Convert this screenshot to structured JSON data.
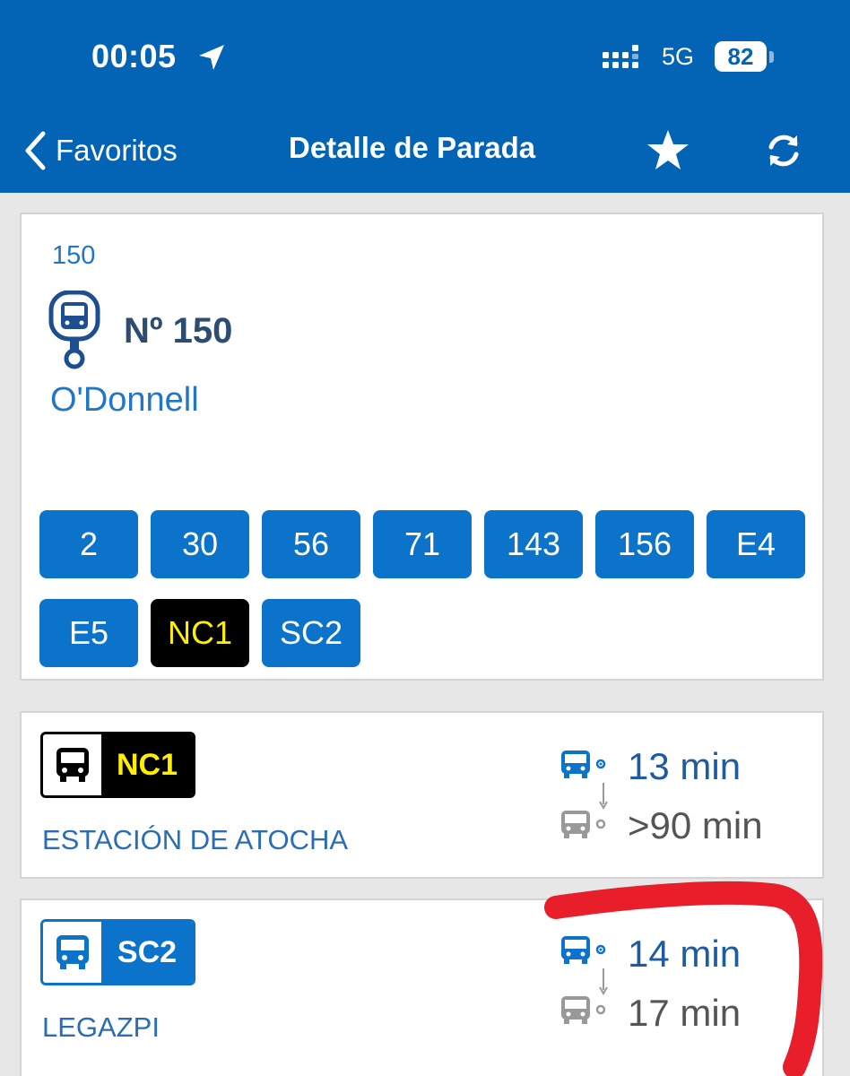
{
  "status_bar": {
    "time": "00:05",
    "network": "5G",
    "battery": "82"
  },
  "nav": {
    "back_label": "Favoritos",
    "title": "Detalle de Parada"
  },
  "stop": {
    "code": "150",
    "number_label": "Nº 150",
    "name": "O'Donnell",
    "lines": [
      "2",
      "30",
      "56",
      "71",
      "143",
      "156",
      "E4",
      "E5",
      "NC1",
      "SC2"
    ]
  },
  "arrivals": [
    {
      "line": "NC1",
      "destination": "ESTACIÓN DE ATOCHA",
      "next": "13 min",
      "following": ">90 min"
    },
    {
      "line": "SC2",
      "destination": "LEGAZPI",
      "next": "14 min",
      "following": "17 min"
    }
  ],
  "colors": {
    "header": "#0363b4",
    "line_chip": "#0b73c9",
    "night_chip_bg": "#000000",
    "night_chip_text": "#ffee00",
    "annotation": "#e81e2a"
  },
  "icons": [
    "location-arrow-icon",
    "signal-icon",
    "back-chevron-icon",
    "star-icon",
    "refresh-icon",
    "bus-stop-icon",
    "bus-icon"
  ]
}
